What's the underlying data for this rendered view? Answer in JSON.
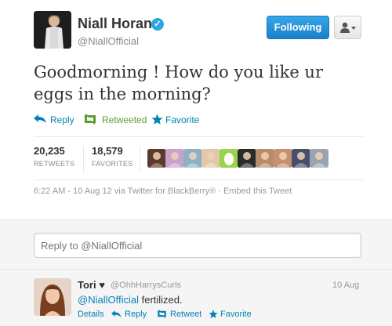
{
  "tweet": {
    "author": {
      "full_name": "Niall Horan",
      "username": "@NiallOfficial",
      "verified_glyph": "✓"
    },
    "follow_button": "Following",
    "text": "Goodmorning ! How do you like ur eggs in the morning?",
    "actions": {
      "reply": "Reply",
      "retweeted": "Retweeted",
      "favorite": "Favorite"
    },
    "stats": {
      "retweets": {
        "value": "20,235",
        "label": "RETWEETS"
      },
      "favorites": {
        "value": "18,579",
        "label": "FAVORITES"
      }
    },
    "favoriter_avatars": [
      {
        "icon": "user-avatar",
        "color": "#5a3b2b"
      },
      {
        "icon": "user-avatar",
        "color": "#c8a2c8"
      },
      {
        "icon": "user-avatar",
        "color": "#8cb0c8"
      },
      {
        "icon": "user-avatar",
        "color": "#e0c8a8"
      },
      {
        "icon": "default-egg-avatar",
        "color": "#9bd44a"
      },
      {
        "icon": "user-avatar",
        "color": "#2a2a2a"
      },
      {
        "icon": "user-avatar",
        "color": "#b78c6a"
      },
      {
        "icon": "user-avatar",
        "color": "#c89070"
      },
      {
        "icon": "user-avatar",
        "color": "#46506a"
      },
      {
        "icon": "user-avatar",
        "color": "#9aa4b0"
      }
    ],
    "meta": "6:22 AM - 10 Aug 12 via Twitter for BlackBerry® · Embed this Tweet"
  },
  "reply_box": {
    "placeholder": "Reply to @NiallOfficial"
  },
  "reply": {
    "name": "Tori ♥",
    "handle": "@OhhHarrysCurls",
    "time": "10 Aug",
    "mention": "@NiallOfficial",
    "text": " fertilized.",
    "actions": {
      "details": "Details",
      "reply": "Reply",
      "retweet": "Retweet",
      "favorite": "Favorite"
    }
  },
  "colors": {
    "link": "#0084b4",
    "retweeted": "#5c9e2e",
    "follow_button": "#2a93d8",
    "verified": "#2fa8e0"
  }
}
